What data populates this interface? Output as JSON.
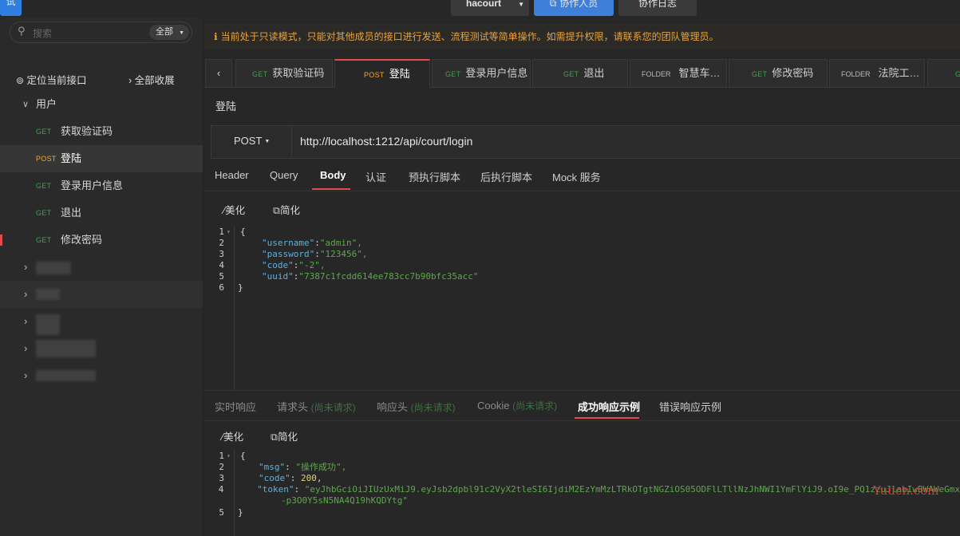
{
  "topbar": {
    "left_label": "试",
    "project": "hacourt",
    "collab_members": "协作人员",
    "collab_log": "协作日志"
  },
  "sidebar": {
    "search_placeholder": "搜索",
    "filter": "全部",
    "locate": "定位当前接口",
    "collapse_all": "全部收展",
    "group": "用户",
    "items": [
      {
        "method": "GET",
        "label": "获取验证码"
      },
      {
        "method": "POST",
        "label": "登陆"
      },
      {
        "method": "GET",
        "label": "登录用户信息"
      },
      {
        "method": "GET",
        "label": "退出"
      },
      {
        "method": "GET",
        "label": "修改密码"
      }
    ]
  },
  "notice": "当前处于只读模式，只能对其他成员的接口进行发送、流程测试等简单操作。如需提升权限，请联系您的团队管理员。",
  "tabs": [
    {
      "type": "GET",
      "label": "获取验证码"
    },
    {
      "type": "POST",
      "label": "登陆"
    },
    {
      "type": "GET",
      "label": "登录用户信息"
    },
    {
      "type": "GET",
      "label": "退出"
    },
    {
      "type": "FOLDER",
      "label": "智慧车…"
    },
    {
      "type": "GET",
      "label": "修改密码"
    },
    {
      "type": "FOLDER",
      "label": "法院工…"
    },
    {
      "type": "G",
      "label": ""
    }
  ],
  "request": {
    "name": "登陆",
    "method": "POST",
    "url": "http://localhost:1212/api/court/login",
    "tabs": [
      "Header",
      "Query",
      "Body",
      "认证",
      "预执行脚本",
      "后执行脚本",
      "Mock 服务"
    ],
    "beautify": "美化",
    "simplify": "简化",
    "body_lines": [
      {
        "n": "1",
        "text": "{"
      },
      {
        "n": "2",
        "key": "\"username\"",
        "val": "\"admin\","
      },
      {
        "n": "3",
        "key": "\"password\"",
        "val": "\"123456\","
      },
      {
        "n": "4",
        "key": "\"code\"",
        "val": "\"-2\","
      },
      {
        "n": "5",
        "key": "\"uuid\"",
        "val": "\"7387c1fcdd614ee783cc7b90bfc35acc\""
      },
      {
        "n": "6",
        "text": "}"
      }
    ]
  },
  "response": {
    "tabs": [
      {
        "label": "实时响应",
        "note": ""
      },
      {
        "label": "请求头",
        "note": "(尚未请求)"
      },
      {
        "label": "响应头",
        "note": "(尚未请求)"
      },
      {
        "label": "Cookie",
        "note": "(尚未请求)"
      },
      {
        "label": "成功响应示例",
        "note": ""
      },
      {
        "label": "错误响应示例",
        "note": ""
      }
    ],
    "beautify": "美化",
    "simplify": "简化",
    "lines": [
      {
        "n": "1",
        "text": "{"
      },
      {
        "n": "2",
        "key": "\"msg\"",
        "sep": ": ",
        "val": "\"操作成功\",",
        "kind": "str"
      },
      {
        "n": "3",
        "key": "\"code\"",
        "sep": ": ",
        "val": "200",
        "tail": ",",
        "kind": "num"
      },
      {
        "n": "4",
        "key": "\"token\"",
        "sep": ": ",
        "val": "\"eyJhbGciOiJIUzUxMiJ9.eyJsb2dpbl91c2VyX2tleSI6IjdiM2EzYmMzLTRkOTgtNGZiOS05ODFlLTllNzJhNWI1YmFlYiJ9.oI9e_PQ1zzuJlabIwBWAWeGmx",
        "kind": "str"
      },
      {
        "n": "",
        "val": "-p3O0Y5sN5NA4Q19hKQDYtg\"",
        "kind": "str"
      },
      {
        "n": "5",
        "text": "}"
      }
    ],
    "watermark": "Yuucn.com"
  }
}
